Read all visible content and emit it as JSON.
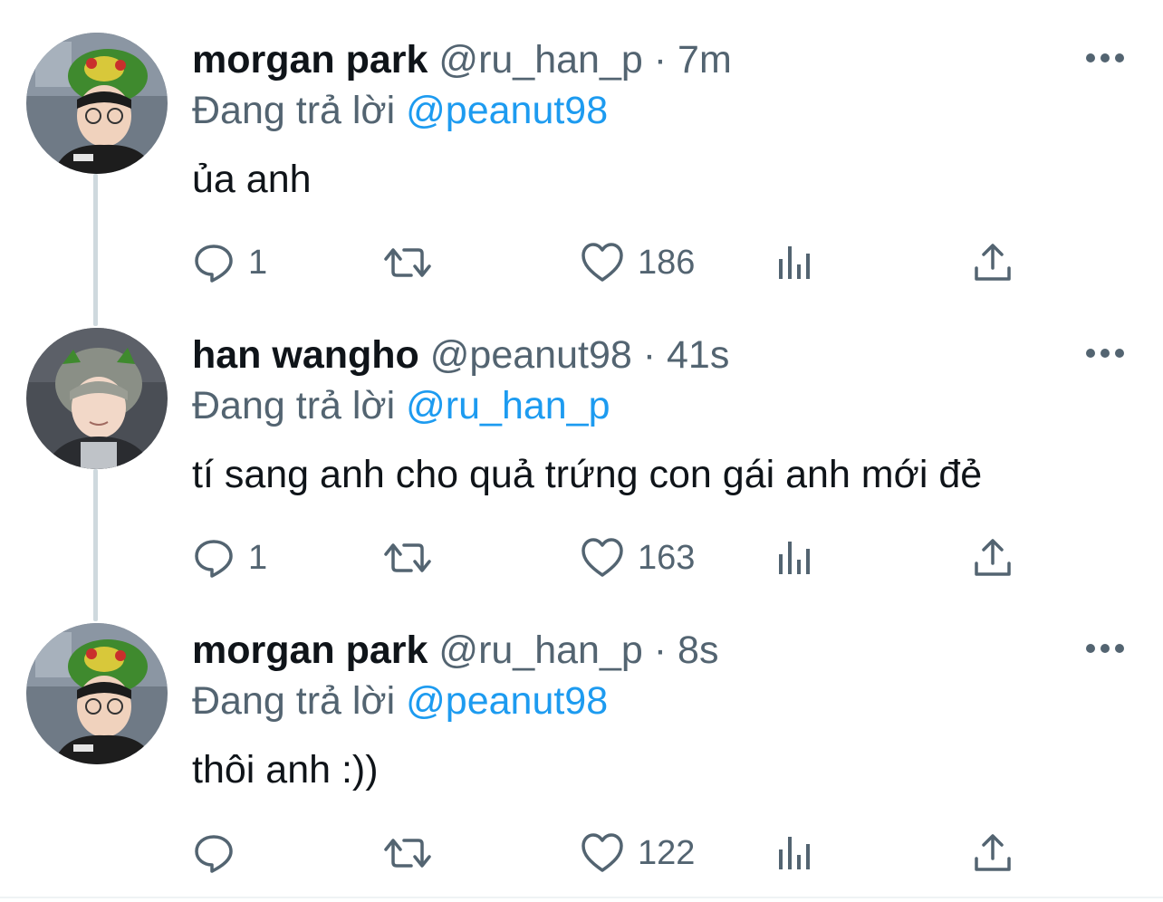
{
  "tweets": [
    {
      "display_name": "morgan park",
      "handle": "@ru_han_p",
      "dot": "·",
      "time": "7m",
      "replying_prefix": "Đang trả lời",
      "replying_to": "@peanut98",
      "text": "ủa anh",
      "replies": "1",
      "retweets": "",
      "likes": "186",
      "avatar_icon": "avatar-morgan-park"
    },
    {
      "display_name": "han wangho",
      "handle": "@peanut98",
      "dot": "·",
      "time": "41s",
      "replying_prefix": "Đang trả lời",
      "replying_to": "@ru_han_p",
      "text": "tí sang anh cho quả trứng con gái anh mới đẻ",
      "replies": "1",
      "retweets": "",
      "likes": "163",
      "avatar_icon": "avatar-han-wangho"
    },
    {
      "display_name": "morgan park",
      "handle": "@ru_han_p",
      "dot": "·",
      "time": "8s",
      "replying_prefix": "Đang trả lời",
      "replying_to": "@peanut98",
      "text": "thôi anh :))",
      "replies": "",
      "retweets": "",
      "likes": "122",
      "avatar_icon": "avatar-morgan-park"
    }
  ],
  "colors": {
    "text": "#0f1419",
    "secondary": "#536471",
    "link": "#1d9bf0",
    "thread_line": "#cfd9de"
  },
  "icons": [
    "reply-icon",
    "retweet-icon",
    "like-icon",
    "stats-icon",
    "share-icon",
    "more-icon"
  ]
}
